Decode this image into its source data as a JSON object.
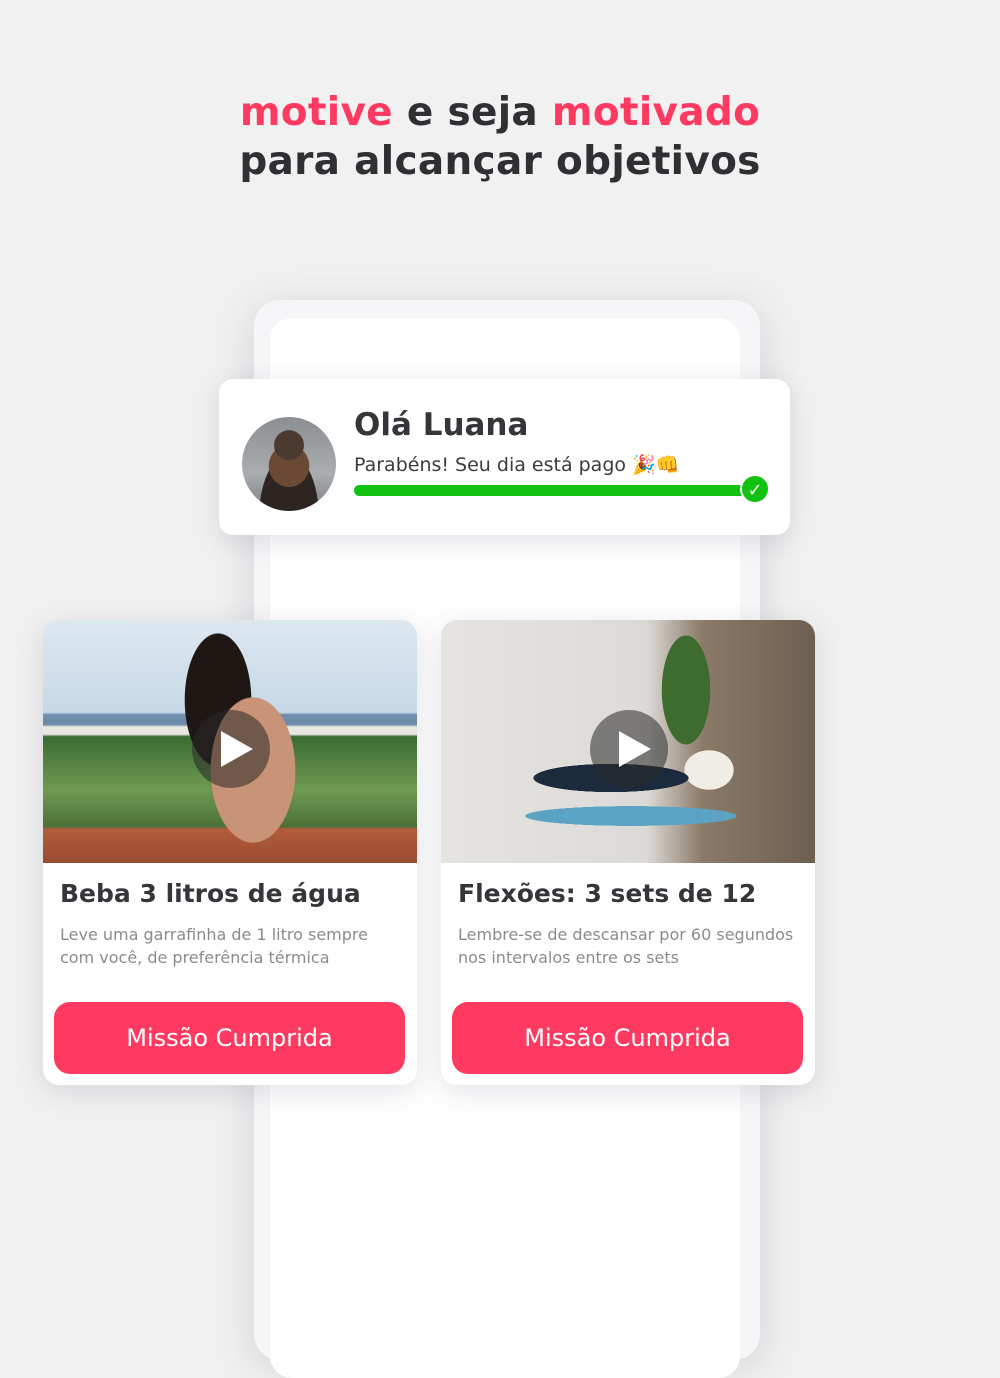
{
  "headline": {
    "line1_part1": "motive",
    "line1_part2": " e seja ",
    "line1_part3": "motivado",
    "line2": "para alcançar objetivos"
  },
  "colors": {
    "accent": "#ff3a61",
    "progress": "#11c210",
    "text_dark": "#35363a"
  },
  "greeting": {
    "title": "Olá Luana",
    "message": "Parabéns! Seu dia está pago 🎉👊",
    "progress": 1.0,
    "status_icon": "check-icon",
    "check_glyph": "✓"
  },
  "missions": [
    {
      "title": "Beba 3 litros de água",
      "description": "Leve uma garrafinha de 1 litro sempre com você, de preferência térmica",
      "button_label": "Missão Cumprida",
      "media_icon": "play-icon"
    },
    {
      "title": "Flexões: 3 sets de 12",
      "description": "Lembre-se de descansar por 60 segundos nos intervalos entre os sets",
      "button_label": "Missão Cumprida",
      "media_icon": "play-icon"
    }
  ]
}
